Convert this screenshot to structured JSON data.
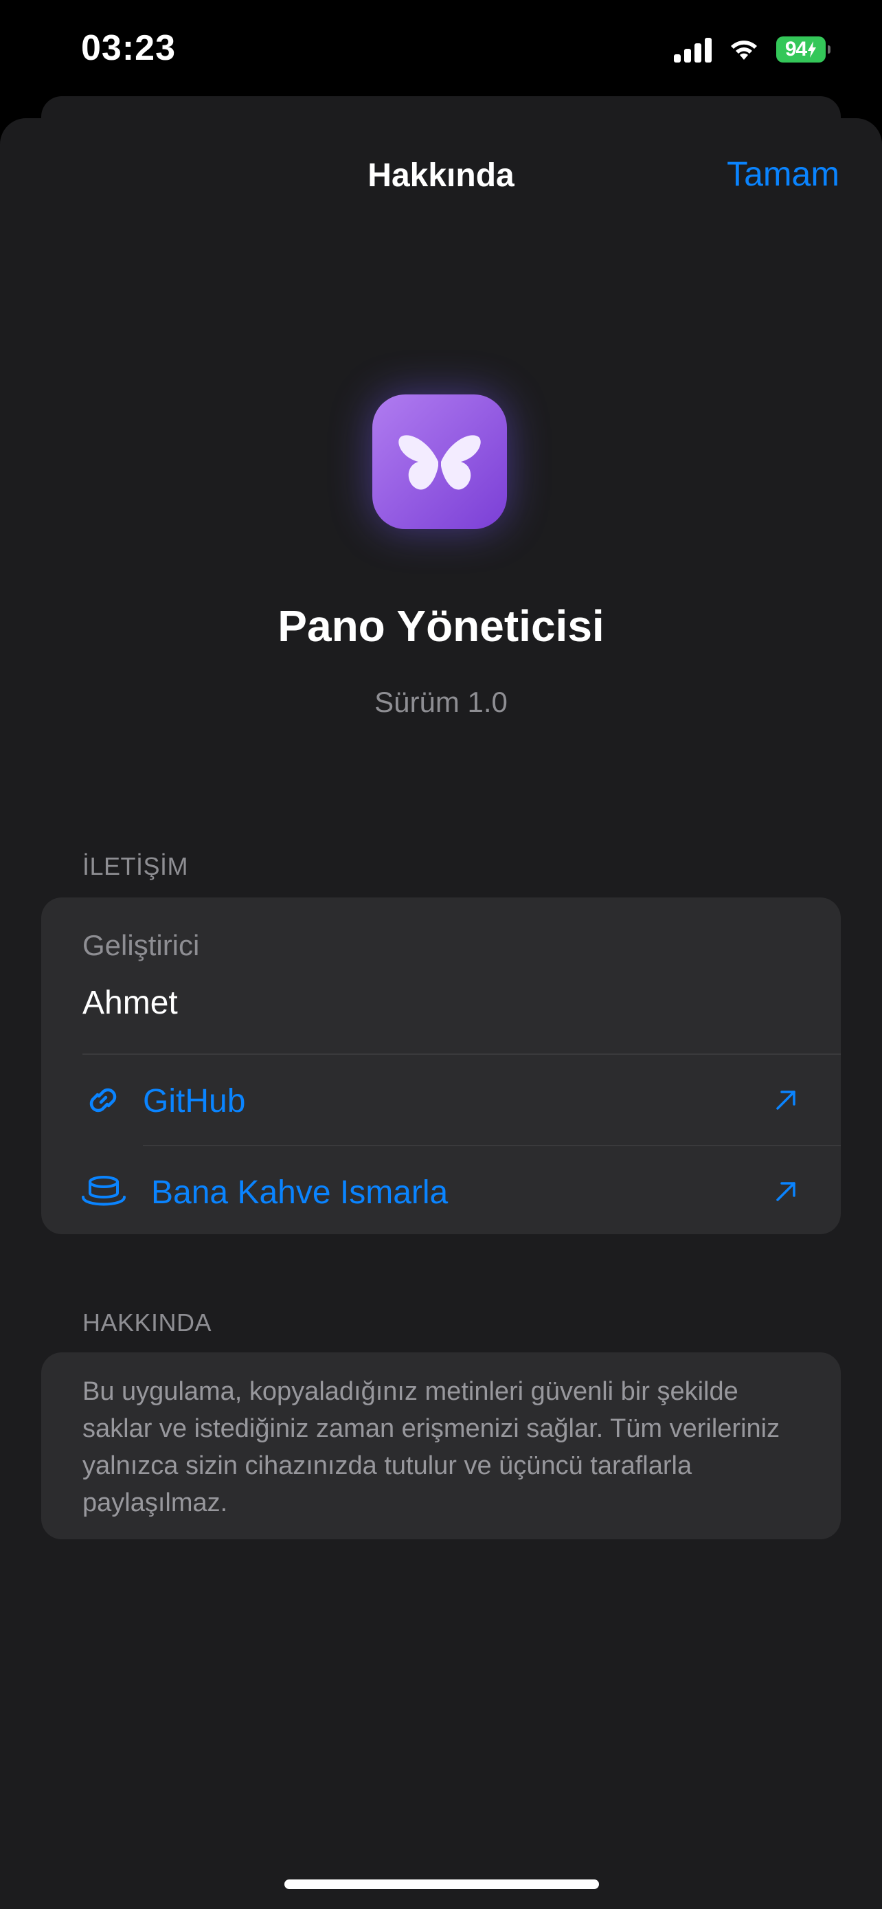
{
  "status_bar": {
    "time": "03:23",
    "battery": "94"
  },
  "nav": {
    "title": "Hakkında",
    "done_label": "Tamam"
  },
  "app": {
    "name": "Pano Yöneticisi",
    "version": "Sürüm 1.0",
    "icon": "butterfly-icon"
  },
  "contact": {
    "header": "İLETİŞİM",
    "developer_label": "Geliştirici",
    "developer_name": "Ahmet",
    "links": [
      {
        "label": "GitHub",
        "icon": "link-icon"
      },
      {
        "label": "Bana Kahve Ismarla",
        "icon": "coffee-cup-icon"
      }
    ]
  },
  "about": {
    "header": "HAKKINDA",
    "text": "Bu uygulama, kopyaladığınız metinleri güvenli bir şekilde saklar ve istediğiniz zaman erişmenizi sağlar. Tüm verileriniz yalnızca sizin cihazınızda tutulur ve üçüncü taraflarla paylaşılmaz."
  },
  "colors": {
    "accent": "#0a84ff",
    "sheet_background": "#1c1c1e",
    "group_background": "#2c2c2e",
    "secondary_text": "#8e8e93",
    "battery": "#34c759",
    "icon_gradient_start": "#b07cf0",
    "icon_gradient_end": "#7b3fd6"
  }
}
